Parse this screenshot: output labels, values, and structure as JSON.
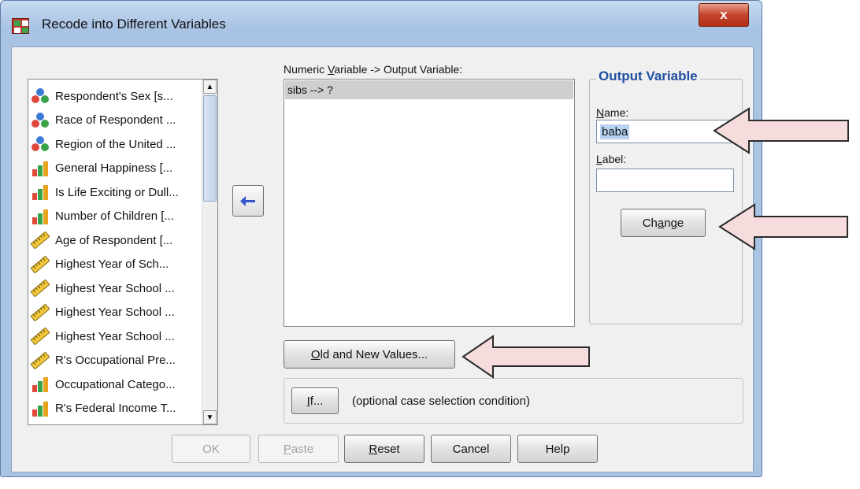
{
  "window": {
    "title": "Recode into Different Variables",
    "close_glyph": "x"
  },
  "variables": [
    {
      "label": "Respondent's Sex [s...",
      "icon": "nominal-icon"
    },
    {
      "label": "Race of Respondent ...",
      "icon": "nominal-icon"
    },
    {
      "label": "Region of the United ...",
      "icon": "nominal-icon"
    },
    {
      "label": "General Happiness [...",
      "icon": "ordinal-icon"
    },
    {
      "label": "Is Life Exciting or Dull...",
      "icon": "ordinal-icon"
    },
    {
      "label": "Number of Children [...",
      "icon": "ordinal-icon"
    },
    {
      "label": "Age of Respondent [...",
      "icon": "scale-icon"
    },
    {
      "label": "Highest Year of Sch...",
      "icon": "scale-icon"
    },
    {
      "label": "Highest Year School ...",
      "icon": "scale-icon"
    },
    {
      "label": "Highest Year School ...",
      "icon": "scale-icon"
    },
    {
      "label": "Highest Year School ...",
      "icon": "scale-icon"
    },
    {
      "label": "R's Occupational Pre...",
      "icon": "scale-icon"
    },
    {
      "label": "Occupational Catego...",
      "icon": "ordinal-icon"
    },
    {
      "label": "R's Federal Income T...",
      "icon": "ordinal-icon"
    }
  ],
  "mapping": {
    "label_pre": "Numeric ",
    "label_u": "V",
    "label_post": "ariable -> Output Variable:",
    "rows": [
      "sibs --> ?"
    ]
  },
  "output_variable": {
    "title": "Output Variable",
    "name_label_u": "N",
    "name_label_rest": "ame:",
    "name_value": "baba",
    "label_label_u": "L",
    "label_label_rest": "abel:",
    "label_value": "",
    "change_pre": "Ch",
    "change_u": "a",
    "change_post": "nge"
  },
  "old_new_button": {
    "u": "O",
    "rest": "ld and New Values..."
  },
  "if_button": {
    "u": "I",
    "rest": "f..."
  },
  "if_caption": "(optional case selection condition)",
  "footer": {
    "ok": "OK",
    "paste_u": "P",
    "paste_rest": "aste",
    "reset_u": "R",
    "reset_rest": "eset",
    "cancel": "Cancel",
    "help": "Help"
  },
  "colors": {
    "accent_title": "#1f4fa0",
    "callout_fill": "#f6dcdc",
    "callout_stroke": "#2b2b2b",
    "selection": "#b7d3f2"
  }
}
